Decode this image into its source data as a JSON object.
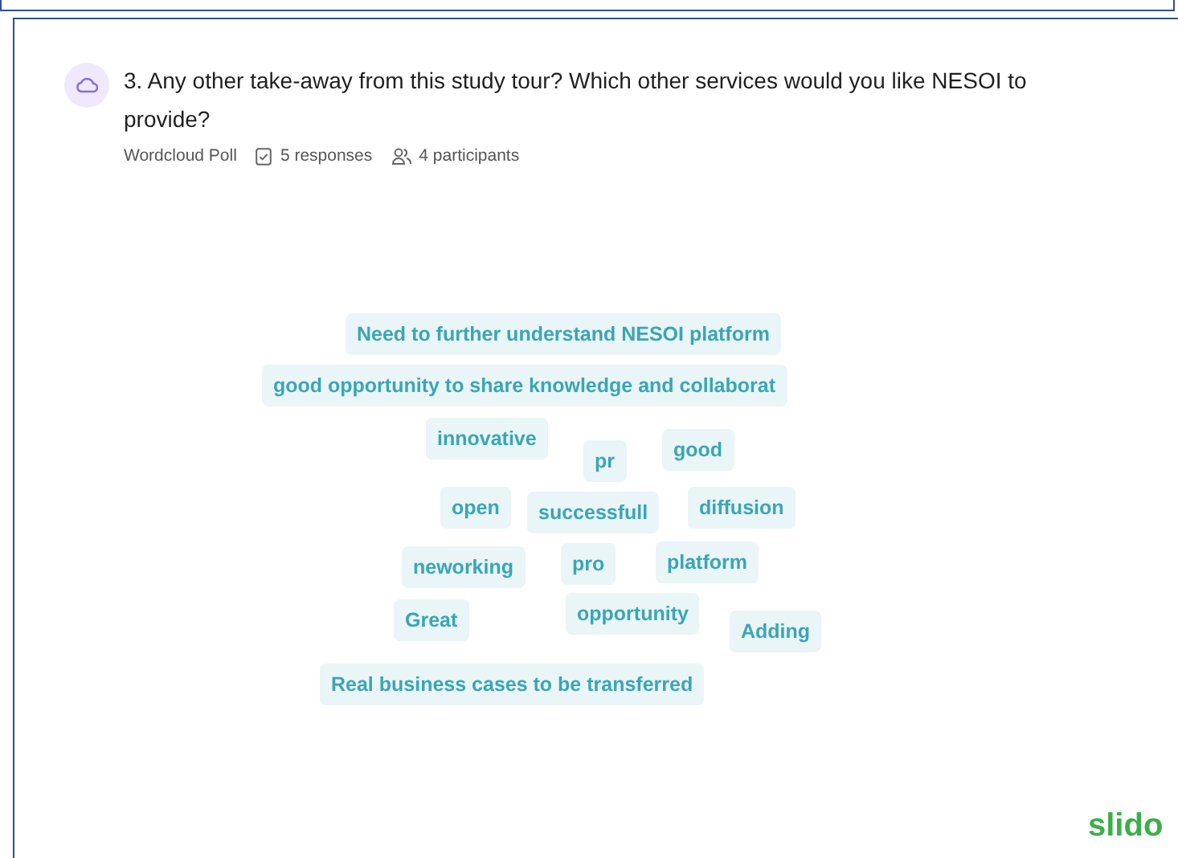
{
  "question": {
    "title": "3. Any other take-away from this study tour? Which other services would you like NESOI to provide?",
    "type": "Wordcloud Poll",
    "responses": "5 responses",
    "participants": "4 participants"
  },
  "words": [
    {
      "text": "Need to further understand NESOI platform"
    },
    {
      "text": "good opportunity to share knowledge and collaborat"
    },
    {
      "text": "innovative"
    },
    {
      "text": "pr"
    },
    {
      "text": "good"
    },
    {
      "text": "open"
    },
    {
      "text": "successfull"
    },
    {
      "text": "diffusion"
    },
    {
      "text": "neworking"
    },
    {
      "text": "pro"
    },
    {
      "text": "platform"
    },
    {
      "text": "Great"
    },
    {
      "text": "opportunity"
    },
    {
      "text": "Adding"
    },
    {
      "text": "Real business cases to be transferred"
    }
  ],
  "brand": "slido"
}
